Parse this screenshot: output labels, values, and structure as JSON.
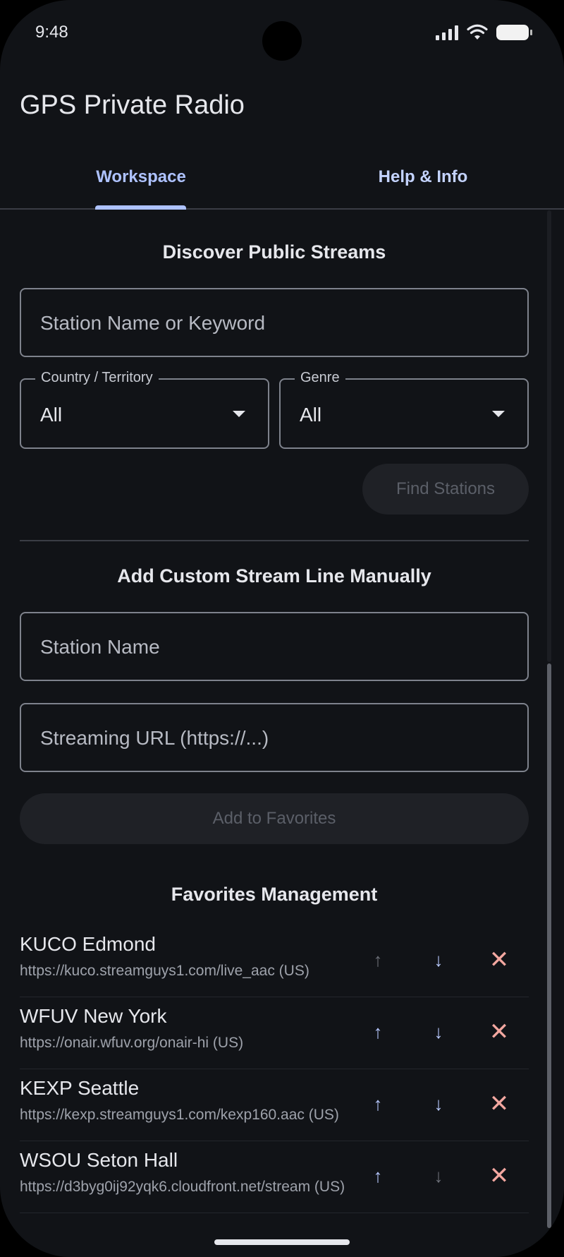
{
  "status_bar": {
    "time": "9:48"
  },
  "app": {
    "title": "GPS Private Radio"
  },
  "tabs": [
    {
      "label": "Workspace",
      "selected": true
    },
    {
      "label": "Help & Info",
      "selected": false
    }
  ],
  "discover": {
    "heading": "Discover Public Streams",
    "search_placeholder": "Station Name or Keyword",
    "country": {
      "label": "Country / Territory",
      "value": "All"
    },
    "genre": {
      "label": "Genre",
      "value": "All"
    },
    "find_button": "Find Stations"
  },
  "custom": {
    "heading": "Add Custom Stream Line Manually",
    "name_placeholder": "Station Name",
    "url_placeholder": "Streaming URL (https://...)",
    "add_button": "Add to Favorites"
  },
  "favorites": {
    "heading": "Favorites Management",
    "items": [
      {
        "name": "KUCO Edmond",
        "url": "https://kuco.streamguys1.com/live_aac (US)",
        "up_enabled": false,
        "down_enabled": true
      },
      {
        "name": "WFUV New York",
        "url": "https://onair.wfuv.org/onair-hi (US)",
        "up_enabled": true,
        "down_enabled": true
      },
      {
        "name": "KEXP Seattle",
        "url": "https://kexp.streamguys1.com/kexp160.aac (US)",
        "up_enabled": true,
        "down_enabled": true
      },
      {
        "name": "WSOU Seton Hall",
        "url": "https://d3byg0ij92yqk6.cloudfront.net/stream (US)",
        "up_enabled": true,
        "down_enabled": false
      }
    ],
    "icons": {
      "up": "arrow-up-icon",
      "down": "arrow-down-icon",
      "delete": "close-icon"
    }
  },
  "colors": {
    "background": "#111317",
    "accent": "#aec2ff",
    "delete": "#f3a7a0",
    "disabled_fill": "#1f2126"
  }
}
